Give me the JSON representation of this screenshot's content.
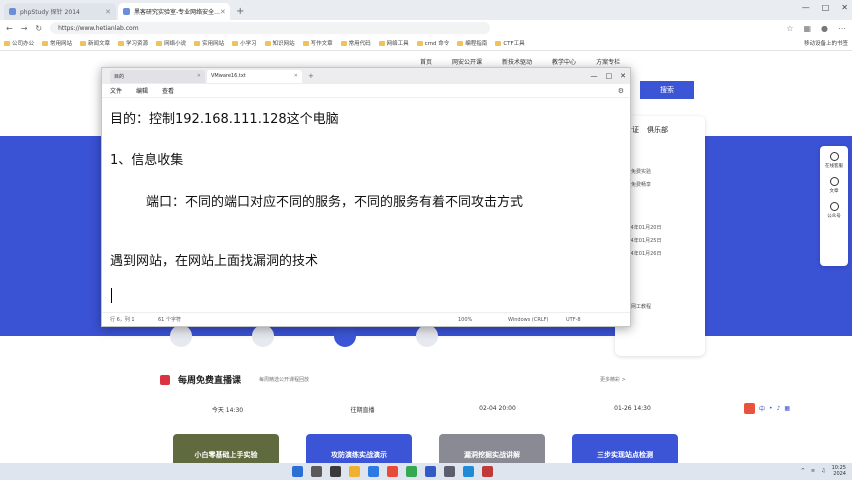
{
  "browser": {
    "tabs": [
      {
        "label": "phpStudy 探针 2014",
        "active": false
      },
      {
        "label": "黑客研究实验室-专业网络安全...",
        "active": true
      }
    ],
    "url": "https://www.hetianlab.com",
    "bookmarks": [
      "公司办公",
      "常用网站",
      "新闻文章",
      "学习资源",
      "网络小说",
      "实用网站",
      "小学习",
      "知识网站",
      "写作文章",
      "常用代码",
      "网络工具",
      "cmd 命令",
      "编程指南",
      "CTF工具"
    ],
    "bookmarks_right": "移动设备上的书签"
  },
  "site": {
    "nav_items": [
      "首页",
      "网安公开课",
      "新技术驱动",
      "教学中心",
      "方案专栏"
    ],
    "search_label": "搜索",
    "hero_links": [
      "考证",
      "俱乐部"
    ],
    "card_lines": [
      "每日免费实验",
      "实验免费畅享",
      "",
      "2024年01月20日",
      "2024年01月25日",
      "2024年01月26日",
      "",
      "",
      "",
      "",
      "",
      "在线网工教程"
    ],
    "sidebar": [
      "在线客服",
      "文章",
      "公众号"
    ],
    "course_title": "每周免费直播课",
    "course_sub": "每周精选公开课程回放",
    "course_more": "更多精彩 >",
    "course_times": [
      "今天 14:30",
      "往期直播",
      "02-04 20:00",
      "01-26 14:30"
    ],
    "course_cards": [
      "小白零基础上手实验",
      "攻防演练实战演示",
      "漏洞挖掘实战讲解",
      "三步实现站点检测"
    ]
  },
  "notepad": {
    "tabs": [
      {
        "label": "目的",
        "active": false
      },
      {
        "label": "VMware16.txt",
        "active": true
      }
    ],
    "menu": [
      "文件",
      "编辑",
      "查看"
    ],
    "lines": [
      "目的：控制192.168.111.128这个电脑",
      "1、信息收集",
      "端口：不同的端口对应不同的服务，不同的服务有着不同攻击方式",
      "遇到网站，在网站上面找漏洞的技术"
    ],
    "status": {
      "position": "行 6，列 1",
      "chars": "61 个字符",
      "zoom": "100%",
      "eol": "Windows (CRLF)",
      "encoding": "UTF-8"
    }
  },
  "taskbar": {
    "time": "10:25",
    "date": "2024"
  },
  "colors": {
    "site_blue": "#3a52d4",
    "accent": "#3c55d6"
  }
}
